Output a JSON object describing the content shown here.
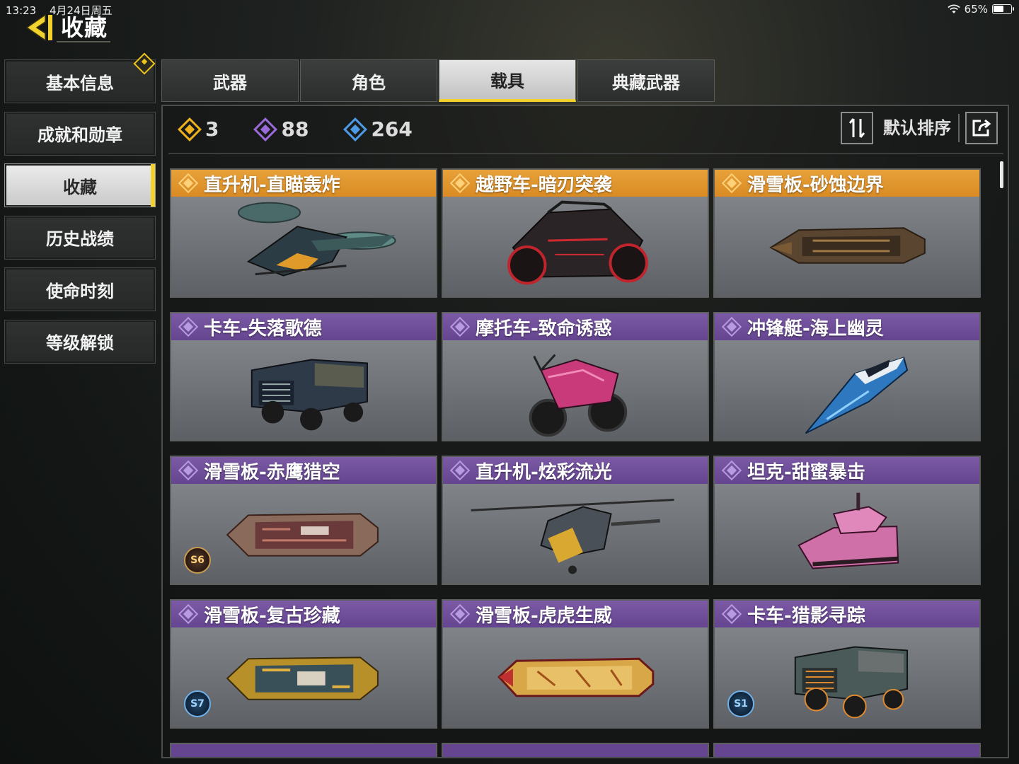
{
  "status_bar": {
    "time": "13:23",
    "date": "4月24日周五",
    "battery_pct": "65%",
    "battery_level": 0.65
  },
  "header": {
    "title": "收藏"
  },
  "sidebar": {
    "items": [
      {
        "label": "基本信息",
        "has_badge": true
      },
      {
        "label": "成就和勋章"
      },
      {
        "label": "收藏",
        "active": true
      },
      {
        "label": "历史战绩"
      },
      {
        "label": "使命时刻"
      },
      {
        "label": "等级解锁"
      }
    ]
  },
  "tabs": [
    {
      "label": "武器"
    },
    {
      "label": "角色"
    },
    {
      "label": "载具",
      "active": true
    },
    {
      "label": "典藏武器"
    }
  ],
  "counters": {
    "legendary": "3",
    "epic": "88",
    "rare": "264"
  },
  "sort": {
    "label": "默认排序"
  },
  "colors": {
    "accent": "#f2d22c",
    "legendary": "#e8a13a",
    "epic": "#7c5aa6",
    "rare": "#4d9be6"
  },
  "vehicles": [
    {
      "name": "直升机-直瞄轰炸",
      "rarity": "gold"
    },
    {
      "name": "越野车-暗刃突袭",
      "rarity": "gold"
    },
    {
      "name": "滑雪板-砂蚀边界",
      "rarity": "gold"
    },
    {
      "name": "卡车-失落歌德",
      "rarity": "purple"
    },
    {
      "name": "摩托车-致命诱惑",
      "rarity": "purple"
    },
    {
      "name": "冲锋艇-海上幽灵",
      "rarity": "purple"
    },
    {
      "name": "滑雪板-赤鹰猎空",
      "rarity": "purple",
      "season": "S6"
    },
    {
      "name": "直升机-炫彩流光",
      "rarity": "purple"
    },
    {
      "name": "坦克-甜蜜暴击",
      "rarity": "purple"
    },
    {
      "name": "滑雪板-复古珍藏",
      "rarity": "purple",
      "season": "S7"
    },
    {
      "name": "滑雪板-虎虎生威",
      "rarity": "purple"
    },
    {
      "name": "卡车-猎影寻踪",
      "rarity": "purple",
      "season": "S1"
    }
  ]
}
